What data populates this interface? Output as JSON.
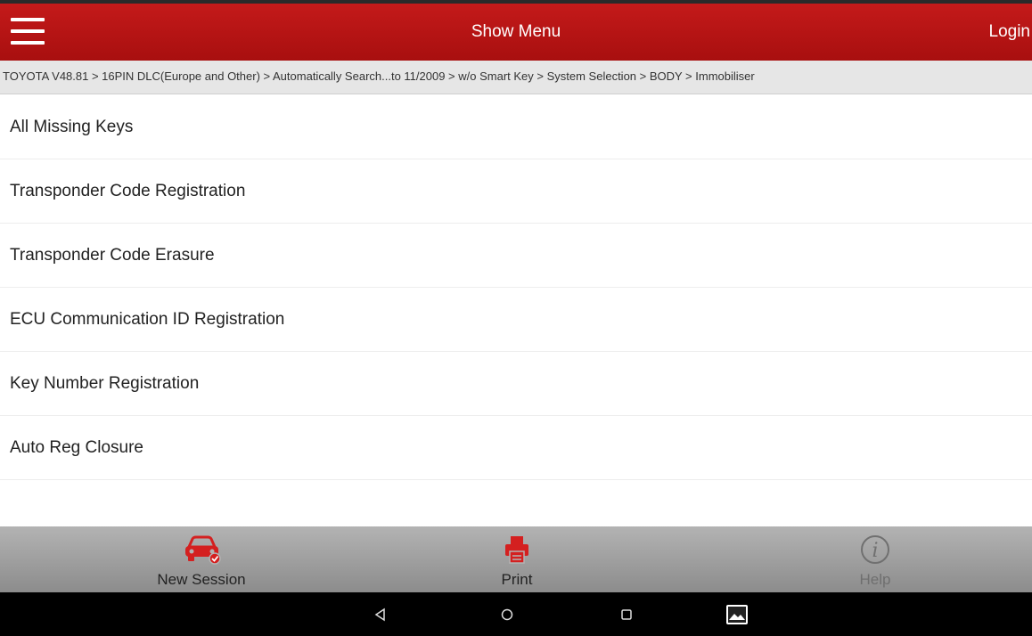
{
  "header": {
    "title": "Show Menu",
    "login_label": "Login"
  },
  "breadcrumb": "TOYOTA V48.81 > 16PIN DLC(Europe and Other) > Automatically Search...to 11/2009 > w/o Smart Key > System Selection > BODY > Immobiliser",
  "menu": {
    "items": [
      {
        "label": "All Missing Keys"
      },
      {
        "label": "Transponder Code Registration"
      },
      {
        "label": "Transponder Code Erasure"
      },
      {
        "label": "ECU Communication ID Registration"
      },
      {
        "label": "Key Number Registration"
      },
      {
        "label": "Auto Reg Closure"
      }
    ]
  },
  "toolbar": {
    "new_session_label": "New Session",
    "print_label": "Print",
    "help_label": "Help"
  },
  "icons": {
    "menu": "hamburger-icon",
    "new_session": "car-icon",
    "print": "printer-icon",
    "help": "info-icon",
    "back": "back-triangle-icon",
    "home": "home-circle-icon",
    "recents": "recents-square-icon",
    "gallery": "gallery-icon"
  },
  "colors": {
    "brand_red": "#b81414",
    "disabled_gray": "#707070"
  }
}
